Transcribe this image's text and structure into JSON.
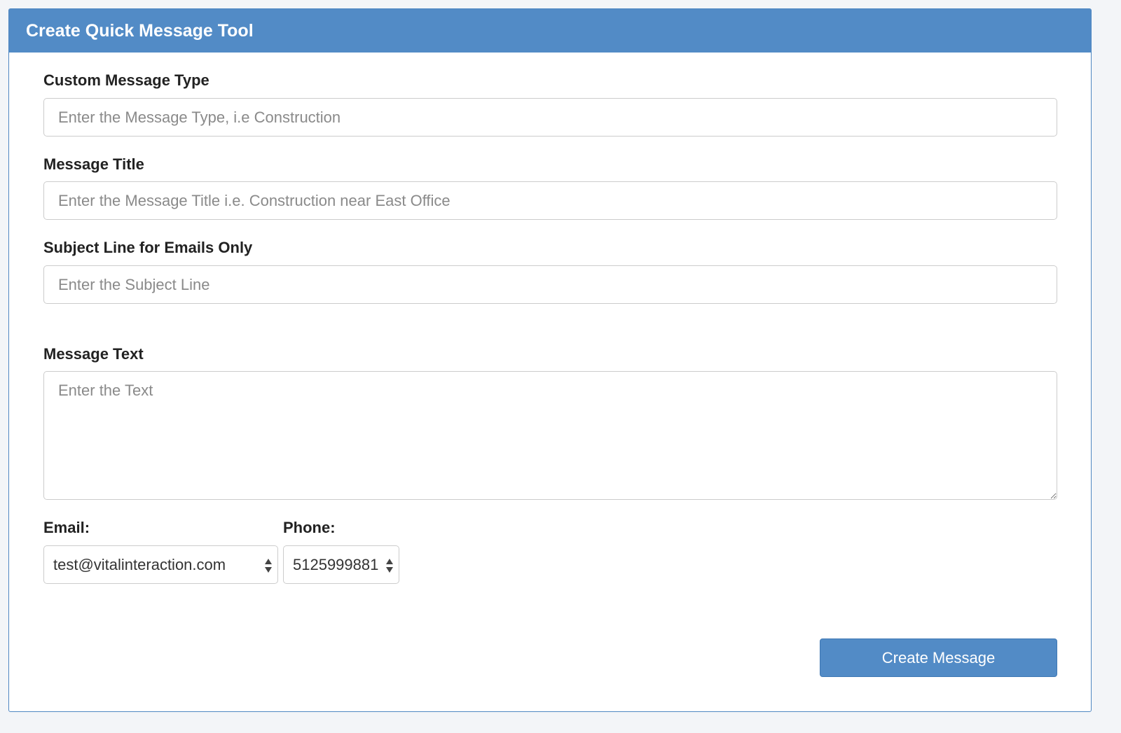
{
  "panel": {
    "title": "Create Quick Message Tool"
  },
  "form": {
    "message_type": {
      "label": "Custom Message Type",
      "placeholder": "Enter the Message Type, i.e Construction",
      "value": ""
    },
    "message_title": {
      "label": "Message Title",
      "placeholder": "Enter the Message Title i.e. Construction near East Office",
      "value": ""
    },
    "subject_line": {
      "label": "Subject Line for Emails Only",
      "placeholder": "Enter the Subject Line",
      "value": ""
    },
    "message_text": {
      "label": "Message Text",
      "placeholder": "Enter the Text",
      "value": ""
    },
    "email": {
      "label": "Email:",
      "selected": "test@vitalinteraction.com"
    },
    "phone": {
      "label": "Phone:",
      "selected": "5125999881"
    },
    "submit_label": "Create Message"
  },
  "icons": {
    "select_arrows": "up-down-arrows-icon"
  },
  "colors": {
    "accent": "#528bc6",
    "background": "#f3f5f8"
  }
}
